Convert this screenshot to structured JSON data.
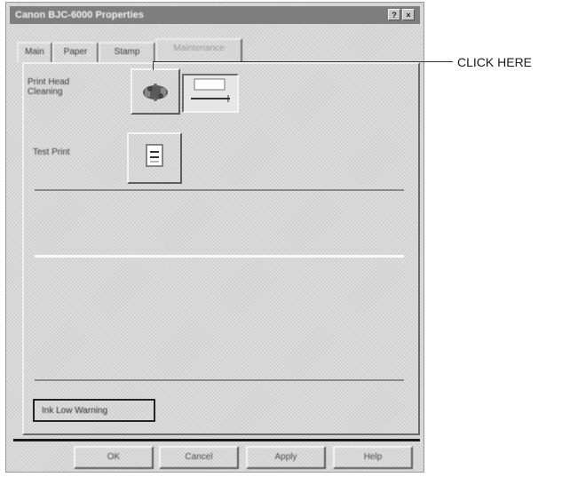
{
  "window": {
    "title": "Canon BJC-6000 Properties",
    "title_buttons": [
      "?",
      "×"
    ]
  },
  "tabs": [
    {
      "label": "Main",
      "active": false
    },
    {
      "label": "Paper",
      "active": false
    },
    {
      "label": "Stamp",
      "active": false
    },
    {
      "label": "Maintenance",
      "active": true
    }
  ],
  "panel": {
    "printhead_label_line1": "Print Head",
    "printhead_label_line2": "Cleaning",
    "test_print_label": "Test Print",
    "bottom_button_label": "Ink Low Warning"
  },
  "buttons": {
    "ok": "OK",
    "cancel": "Cancel",
    "apply": "Apply",
    "help": "Help"
  },
  "callout": {
    "text": "CLICK HERE"
  }
}
